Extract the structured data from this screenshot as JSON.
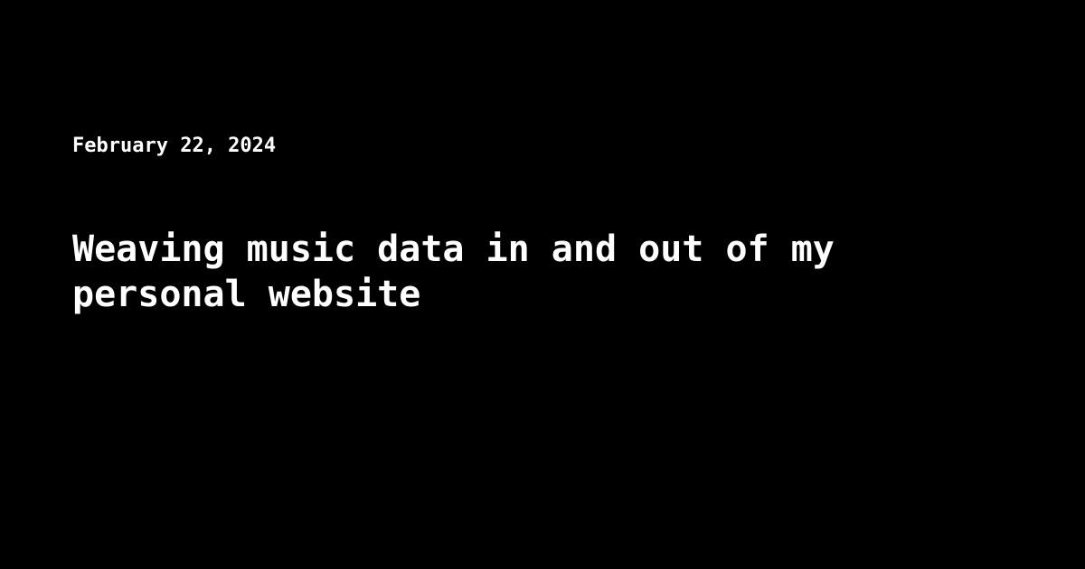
{
  "post": {
    "date": "February 22, 2024",
    "title": "Weaving music data in and out of my personal website"
  },
  "colors": {
    "background": "#000000",
    "text": "#ffffff"
  }
}
